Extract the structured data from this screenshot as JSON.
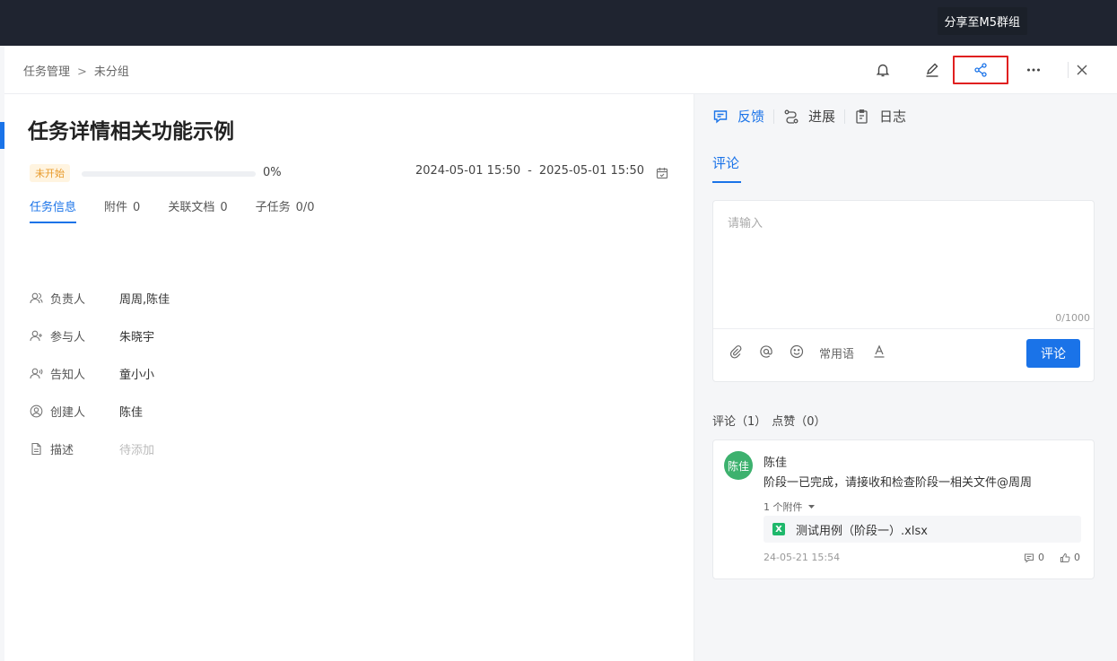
{
  "tooltip": "分享至M5群组",
  "breadcrumb": {
    "root": "任务管理",
    "separator": ">",
    "current": "未分组"
  },
  "task": {
    "title": "任务详情相关功能示例",
    "status": "未开始",
    "progress_percent": 0,
    "progress_label": "0%",
    "start": "2024-05-01 15:50",
    "date_separator": "-",
    "end": "2025-05-01 15:50"
  },
  "tabs": [
    {
      "label": "任务信息",
      "count": ""
    },
    {
      "label": "附件",
      "count": "0"
    },
    {
      "label": "关联文档",
      "count": "0"
    },
    {
      "label": "子任务",
      "count": "0/0"
    }
  ],
  "info": {
    "assignee": {
      "label": "负责人",
      "value": "周周,陈佳"
    },
    "participant": {
      "label": "参与人",
      "value": "朱晓宇"
    },
    "notify": {
      "label": "告知人",
      "value": "童小小"
    },
    "creator": {
      "label": "创建人",
      "value": "陈佳"
    },
    "description": {
      "label": "描述",
      "value": "待添加"
    }
  },
  "right_tabs": {
    "feedback": "反馈",
    "progress": "进展",
    "log": "日志"
  },
  "comment_section": {
    "title": "评论",
    "placeholder": "请输入",
    "char_count": "0/1000",
    "phrase_label": "常用语",
    "submit_label": "评论",
    "stats": {
      "comments": "评论（1）",
      "likes": "点赞（0）"
    }
  },
  "comment": {
    "avatar_text": "陈佳",
    "author": "陈佳",
    "body": "阶段一已完成，请接收和检查阶段一相关文件@周周",
    "attachment_toggle": "1 个附件",
    "file_icon": "X",
    "file_name": "测试用例（阶段一）.xlsx",
    "time": "24-05-21 15:54",
    "reply_count": "0",
    "like_count": "0"
  },
  "colors": {
    "accent": "#1a73e8",
    "highlight_border": "#e02020",
    "avatar_bg": "#3db16e",
    "status_text": "#e89a2a"
  }
}
